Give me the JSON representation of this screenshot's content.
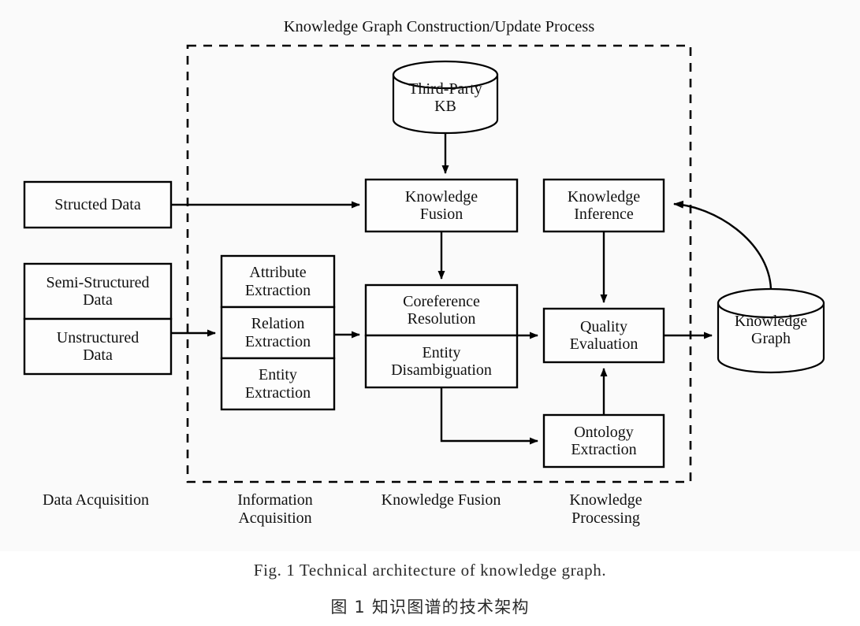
{
  "figure": {
    "process_title": "Knowledge Graph Construction/Update Process",
    "boundary": {
      "style": "dashed",
      "color": "#000000"
    },
    "background": "#fafafa",
    "line_color": "#000000"
  },
  "nodes": {
    "structed_data": {
      "label": "Structed Data",
      "shape": "rect"
    },
    "semi_structured_data": {
      "label": "Semi-Structured\nData",
      "shape": "rect"
    },
    "unstructured_data": {
      "label": "Unstructured\nData",
      "shape": "rect"
    },
    "attribute_extraction": {
      "label": "Attribute\nExtraction",
      "shape": "rect"
    },
    "relation_extraction": {
      "label": "Relation\nExtraction",
      "shape": "rect"
    },
    "entity_extraction": {
      "label": "Entity\nExtraction",
      "shape": "rect"
    },
    "third_party_kb": {
      "label": "Third-Party\nKB",
      "shape": "cylinder"
    },
    "knowledge_fusion": {
      "label": "Knowledge\nFusion",
      "shape": "rect"
    },
    "coreference_resolution": {
      "label": "Coreference\nResolution",
      "shape": "rect"
    },
    "entity_disambiguation": {
      "label": "Entity\nDisambiguation",
      "shape": "rect"
    },
    "knowledge_inference": {
      "label": "Knowledge\nInference",
      "shape": "rect"
    },
    "quality_evaluation": {
      "label": "Quality\nEvaluation",
      "shape": "rect"
    },
    "ontology_extraction": {
      "label": "Ontology\nExtraction",
      "shape": "rect"
    },
    "knowledge_graph": {
      "label": "Knowledge\nGraph",
      "shape": "cylinder"
    }
  },
  "stages": [
    {
      "id": "data-acquisition",
      "label": "Data Acquisition"
    },
    {
      "id": "information-acquisition",
      "label": "Information\nAcquisition"
    },
    {
      "id": "knowledge-fusion",
      "label": "Knowledge Fusion"
    },
    {
      "id": "knowledge-processing",
      "label": "Knowledge\nProcessing"
    }
  ],
  "edges": [
    {
      "from": "structed_data",
      "to": "knowledge_fusion",
      "type": "arrow"
    },
    {
      "from": "semi_unstructured_data",
      "to": "relation_extraction",
      "type": "arrow"
    },
    {
      "from": "third_party_kb",
      "to": "knowledge_fusion",
      "type": "arrow"
    },
    {
      "from": "relation_extraction",
      "to": "coreference_entity",
      "type": "arrow"
    },
    {
      "from": "knowledge_fusion",
      "to": "coreference_resolution",
      "type": "arrow"
    },
    {
      "from": "entity_disambiguation",
      "to": "quality_evaluation",
      "type": "arrow"
    },
    {
      "from": "entity_disambiguation",
      "to": "ontology_extraction",
      "type": "elbow-arrow"
    },
    {
      "from": "ontology_extraction",
      "to": "quality_evaluation",
      "type": "arrow"
    },
    {
      "from": "knowledge_inference",
      "to": "quality_evaluation",
      "type": "arrow"
    },
    {
      "from": "quality_evaluation",
      "to": "knowledge_graph",
      "type": "arrow"
    },
    {
      "from": "knowledge_graph",
      "to": "knowledge_inference",
      "type": "curved-arrow"
    }
  ],
  "caption": {
    "english": "Fig. 1   Technical architecture of knowledge graph.",
    "chinese": "图 1    知识图谱的技术架构"
  }
}
